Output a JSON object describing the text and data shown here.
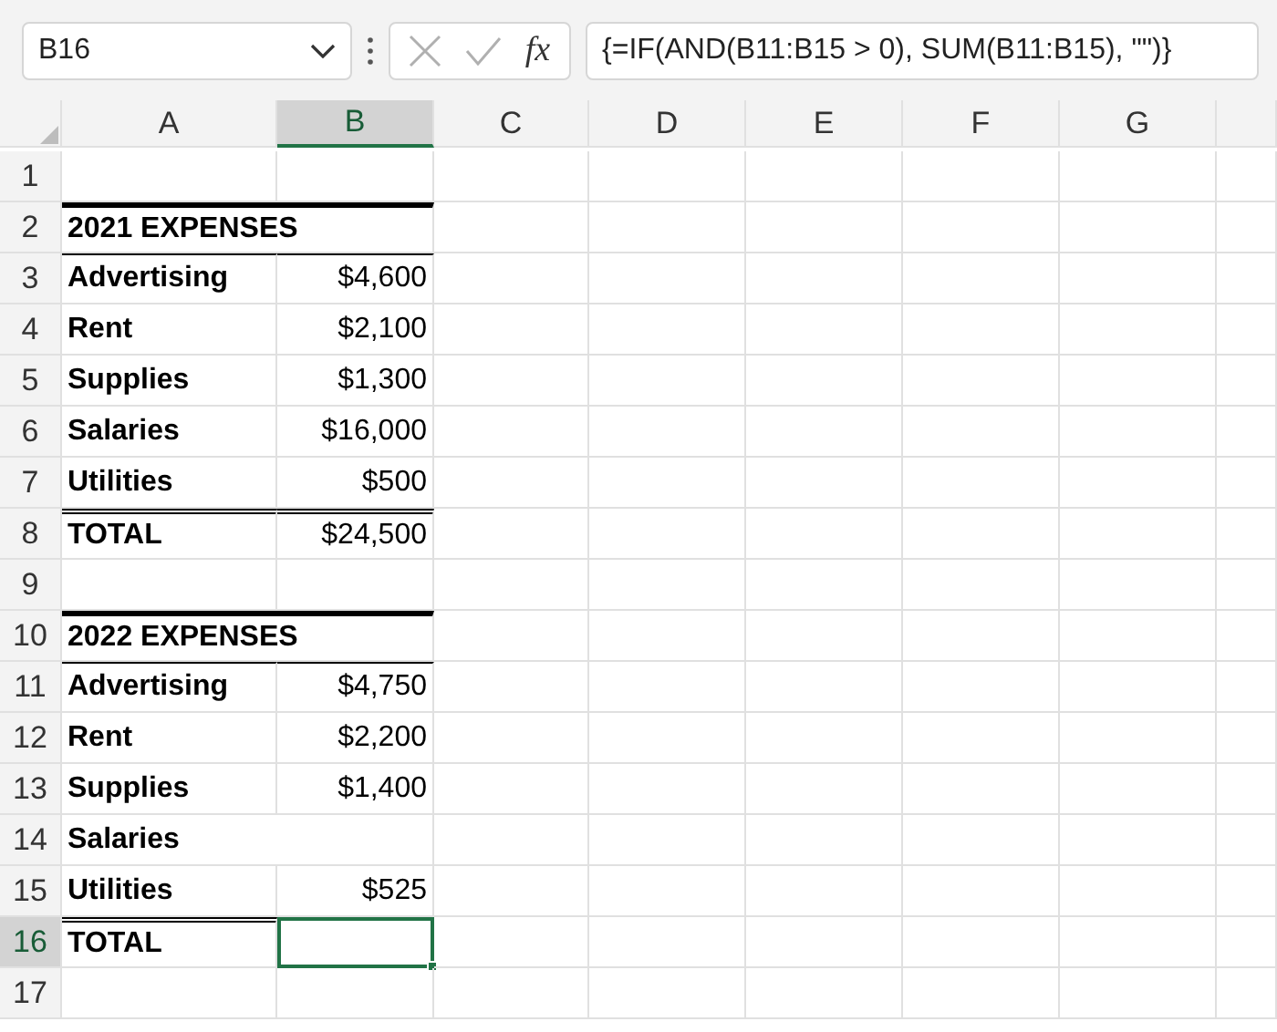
{
  "name_box": "B16",
  "fx_label": "fx",
  "formula": "{=IF(AND(B11:B15 > 0), SUM(B11:B15), \"\")}",
  "columns": [
    {
      "label": "A",
      "selected": false
    },
    {
      "label": "B",
      "selected": true
    },
    {
      "label": "C",
      "selected": false
    },
    {
      "label": "D",
      "selected": false
    },
    {
      "label": "E",
      "selected": false
    },
    {
      "label": "F",
      "selected": false
    },
    {
      "label": "G",
      "selected": false
    }
  ],
  "rows": [
    {
      "number": "1",
      "selected": false,
      "cells": [
        {},
        {}
      ]
    },
    {
      "number": "2",
      "selected": false,
      "cells": [
        {
          "text": "2021 EXPENSES",
          "thick_top": true
        },
        {
          "thick_top": true
        }
      ]
    },
    {
      "number": "3",
      "selected": false,
      "cells": [
        {
          "text": "Advertising",
          "thin_top": true
        },
        {
          "text": "$4,600",
          "thin_top": true
        }
      ]
    },
    {
      "number": "4",
      "selected": false,
      "cells": [
        {
          "text": "Rent"
        },
        {
          "text": "$2,100"
        }
      ]
    },
    {
      "number": "5",
      "selected": false,
      "cells": [
        {
          "text": "Supplies"
        },
        {
          "text": "$1,300"
        }
      ]
    },
    {
      "number": "6",
      "selected": false,
      "cells": [
        {
          "text": "Salaries"
        },
        {
          "text": "$16,000"
        }
      ]
    },
    {
      "number": "7",
      "selected": false,
      "cells": [
        {
          "text": "Utilities"
        },
        {
          "text": "$500"
        }
      ]
    },
    {
      "number": "8",
      "selected": false,
      "cells": [
        {
          "text": "TOTAL",
          "double_top": true
        },
        {
          "text": "$24,500",
          "double_top": true
        }
      ]
    },
    {
      "number": "9",
      "selected": false,
      "cells": [
        {},
        {}
      ]
    },
    {
      "number": "10",
      "selected": false,
      "cells": [
        {
          "text": "2022 EXPENSES",
          "thick_top": true
        },
        {
          "thick_top": true
        }
      ]
    },
    {
      "number": "11",
      "selected": false,
      "cells": [
        {
          "text": "Advertising",
          "thin_top": true
        },
        {
          "text": "$4,750",
          "thin_top": true
        }
      ]
    },
    {
      "number": "12",
      "selected": false,
      "cells": [
        {
          "text": "Rent"
        },
        {
          "text": "$2,200"
        }
      ]
    },
    {
      "number": "13",
      "selected": false,
      "cells": [
        {
          "text": "Supplies"
        },
        {
          "text": "$1,400"
        }
      ]
    },
    {
      "number": "14",
      "selected": false,
      "cells": [
        {
          "text": "Salaries"
        },
        {}
      ]
    },
    {
      "number": "15",
      "selected": false,
      "cells": [
        {
          "text": "Utilities"
        },
        {
          "text": "$525"
        }
      ]
    },
    {
      "number": "16",
      "selected": true,
      "cells": [
        {
          "text": "TOTAL",
          "double_top": true
        },
        {}
      ]
    },
    {
      "number": "17",
      "selected": false,
      "cells": [
        {},
        {}
      ]
    }
  ]
}
